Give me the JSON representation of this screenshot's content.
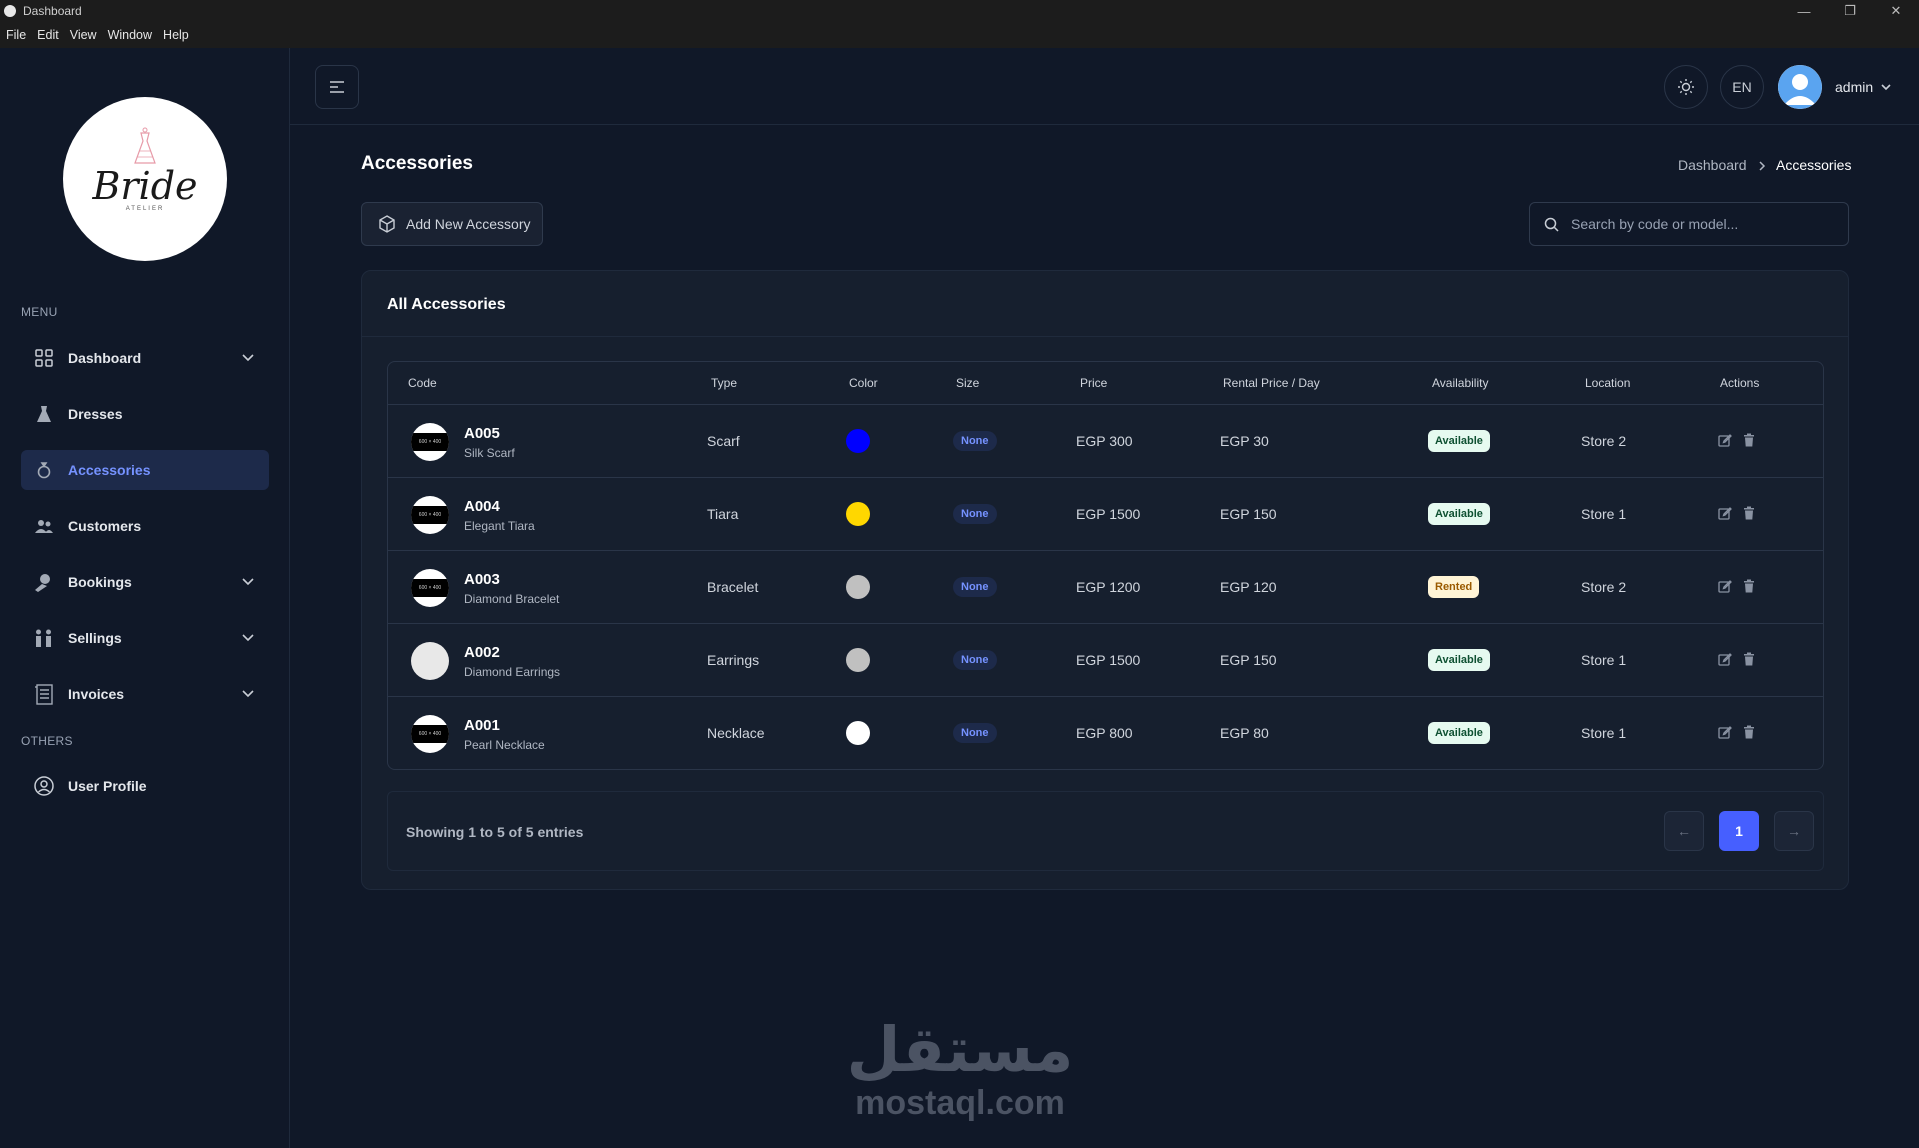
{
  "window": {
    "title": "Dashboard",
    "controls": [
      "—",
      "❐",
      "✕"
    ]
  },
  "menubar": [
    "File",
    "Edit",
    "View",
    "Window",
    "Help"
  ],
  "sidebar": {
    "logo": {
      "brand": "Bride",
      "sub": "ATELIER"
    },
    "menu_label": "MENU",
    "items": [
      {
        "label": "Dashboard",
        "icon": "grid-icon",
        "has_chevron": true
      },
      {
        "label": "Dresses",
        "icon": "dress-icon",
        "has_chevron": false
      },
      {
        "label": "Accessories",
        "icon": "ring-icon",
        "has_chevron": false,
        "active": true
      },
      {
        "label": "Customers",
        "icon": "users-icon",
        "has_chevron": false
      },
      {
        "label": "Bookings",
        "icon": "booking-icon",
        "has_chevron": true
      },
      {
        "label": "Sellings",
        "icon": "sellings-icon",
        "has_chevron": true
      },
      {
        "label": "Invoices",
        "icon": "invoice-icon",
        "has_chevron": true
      }
    ],
    "others_label": "OTHERS",
    "others_items": [
      {
        "label": "User Profile",
        "icon": "user-circle-icon"
      }
    ]
  },
  "header": {
    "lang": "EN",
    "username": "admin"
  },
  "page": {
    "title": "Accessories",
    "breadcrumb": {
      "root": "Dashboard",
      "current": "Accessories"
    },
    "add_button": "Add New Accessory",
    "search_placeholder": "Search by code or model..."
  },
  "table": {
    "title": "All Accessories",
    "columns": [
      "Code",
      "Type",
      "Color",
      "Size",
      "Price",
      "Rental Price / Day",
      "Availability",
      "Location",
      "Actions"
    ],
    "rows": [
      {
        "code": "A005",
        "model": "Silk Scarf",
        "type": "Scarf",
        "color": "#0000ff",
        "size": "None",
        "price": "EGP 300",
        "rental": "EGP 30",
        "availability": "Available",
        "location": "Store 2",
        "thumb_text": "600 × 400"
      },
      {
        "code": "A004",
        "model": "Elegant Tiara",
        "type": "Tiara",
        "color": "#ffd700",
        "size": "None",
        "price": "EGP 1500",
        "rental": "EGP 150",
        "availability": "Available",
        "location": "Store 1",
        "thumb_text": "600 × 400"
      },
      {
        "code": "A003",
        "model": "Diamond Bracelet",
        "type": "Bracelet",
        "color": "#c0c0c0",
        "size": "None",
        "price": "EGP 1200",
        "rental": "EGP 120",
        "availability": "Rented",
        "location": "Store 2",
        "thumb_text": "600 × 400"
      },
      {
        "code": "A002",
        "model": "Diamond Earrings",
        "type": "Earrings",
        "color": "#c0c0c0",
        "size": "None",
        "price": "EGP 1500",
        "rental": "EGP 150",
        "availability": "Available",
        "location": "Store 1",
        "thumb_text": ""
      },
      {
        "code": "A001",
        "model": "Pearl Necklace",
        "type": "Necklace",
        "color": "#ffffff",
        "size": "None",
        "price": "EGP 800",
        "rental": "EGP 80",
        "availability": "Available",
        "location": "Store 1",
        "thumb_text": "600 × 400"
      }
    ],
    "showing": "Showing 1 to 5 of 5 entries",
    "pagination": {
      "prev": "←",
      "current": "1",
      "next": "→"
    }
  },
  "watermark": {
    "arabic": "مستقل",
    "latin": "mostaql.com"
  },
  "colors": {
    "accent": "#465fff",
    "active_nav_bg": "#1d2a4a",
    "background": "#101828"
  }
}
